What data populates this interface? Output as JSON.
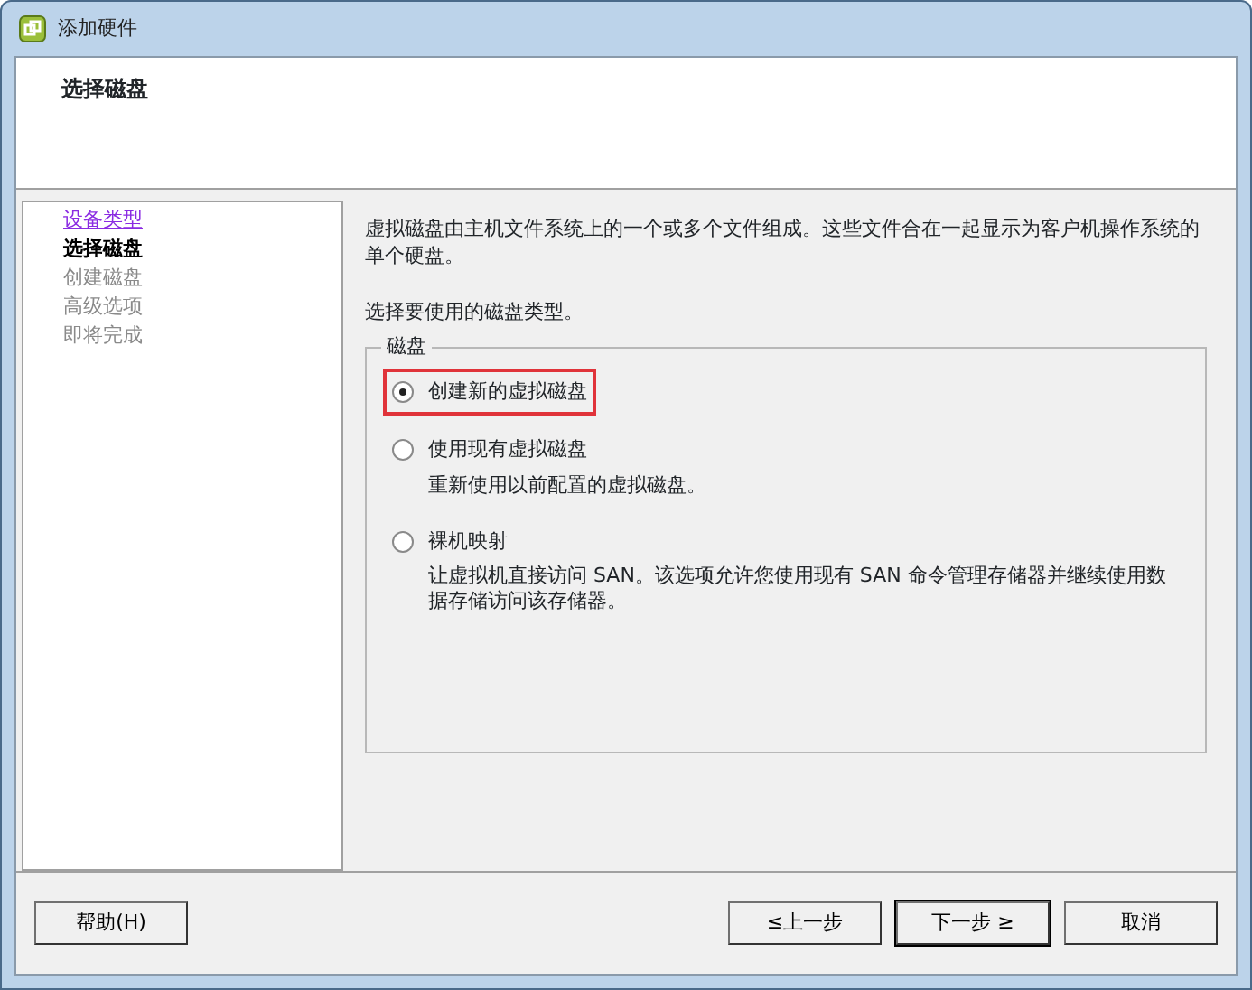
{
  "window": {
    "title": "添加硬件"
  },
  "header": {
    "title": "选择磁盘"
  },
  "steps": [
    {
      "label": "设备类型",
      "visited": true,
      "selected": false
    },
    {
      "label": "选择磁盘",
      "visited": false,
      "selected": true
    },
    {
      "label": "创建磁盘",
      "visited": false,
      "selected": false
    },
    {
      "label": "高级选项",
      "visited": false,
      "selected": false
    },
    {
      "label": "即将完成",
      "visited": false,
      "selected": false
    }
  ],
  "content": {
    "intro": "虚拟磁盘由主机文件系统上的一个或多个文件组成。这些文件合在一起显示为客户机操作系统的单个硬盘。",
    "prompt": "选择要使用的磁盘类型。",
    "group": {
      "legend": "磁盘",
      "options": [
        {
          "label": "创建新的虚拟磁盘",
          "selected": true,
          "highlighted": true
        },
        {
          "label": "使用现有虚拟磁盘",
          "description": "重新使用以前配置的虚拟磁盘。",
          "selected": false
        },
        {
          "label": "裸机映射",
          "description": "让虚拟机直接访问 SAN。该选项允许您使用现有 SAN 命令管理存储器并继续使用数据存储访问该存储器。",
          "selected": false
        }
      ]
    }
  },
  "buttons": {
    "left": [
      {
        "label": "帮助(H)",
        "default": false
      }
    ],
    "right": [
      {
        "label": "≤上一步",
        "default": false
      },
      {
        "label": "下一步 ≥",
        "default": true
      },
      {
        "label": "取消",
        "default": false
      }
    ]
  }
}
